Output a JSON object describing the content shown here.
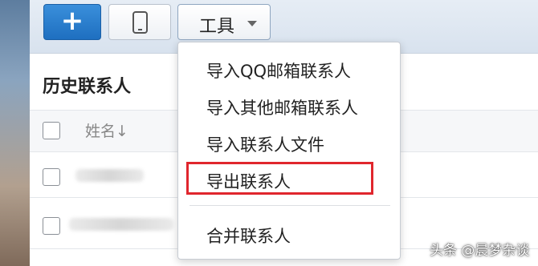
{
  "toolbar": {
    "add_button": {
      "label": "+",
      "icon": "plus-icon"
    },
    "phone_button": {
      "icon": "phone-icon"
    },
    "tools_button": {
      "label": "工具",
      "icon": "chevron-down-icon"
    }
  },
  "main": {
    "title": "历史联系人",
    "table": {
      "columns": [
        {
          "label": "姓名↓"
        }
      ],
      "rows": [
        {
          "name": ""
        },
        {
          "name": ""
        }
      ]
    }
  },
  "tools_menu": {
    "items": [
      {
        "label": "导入QQ邮箱联系人"
      },
      {
        "label": "导入其他邮箱联系人"
      },
      {
        "label": "导入联系人文件"
      },
      {
        "label": "导出联系人",
        "highlighted": true
      },
      {
        "label": "合并联系人"
      }
    ],
    "highlight_color": "#e0262d"
  },
  "watermark": {
    "text": "头条 @晨梦杂谈"
  }
}
